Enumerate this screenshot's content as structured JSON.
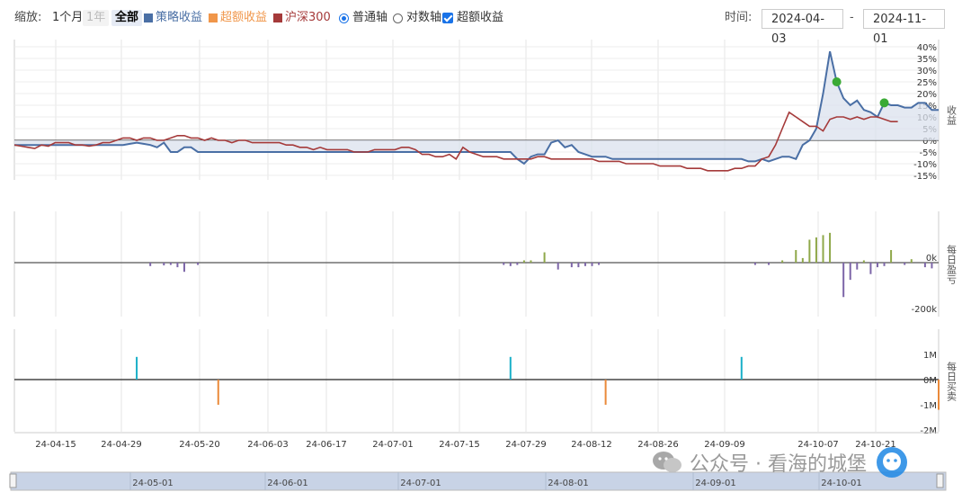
{
  "toolbar": {
    "zoom_label": "缩放:",
    "zoom_buttons": [
      "1个月",
      "1年",
      "全部"
    ],
    "legend": [
      {
        "label": "策略收益",
        "color": "#4a6fa5"
      },
      {
        "label": "超额收益",
        "color": "#f0964a"
      },
      {
        "label": "沪深300",
        "color": "#a53a3a"
      }
    ],
    "axis_modes": [
      "普通轴",
      "对数轴"
    ],
    "excess_toggle": "超额收益",
    "time_label": "时间:",
    "start_date": "2024-04-03",
    "date_separator": "-",
    "end_date": "2024-11-01"
  },
  "chart_data": [
    {
      "type": "line",
      "x_tick_labels": [
        "24-04-15",
        "24-04-29",
        "24-05-20",
        "24-06-03",
        "24-06-17",
        "24-07-01",
        "24-07-15",
        "24-07-29",
        "24-08-12",
        "24-08-26",
        "24-09-09",
        "24-10-07",
        "24-10-21"
      ],
      "ylabel": "收益",
      "y_tick_labels": [
        "40%",
        "35%",
        "30%",
        "25%",
        "20%",
        "15%",
        "10%",
        "5%",
        "0%",
        "-5%",
        "-10%",
        "-15%"
      ],
      "ylim": [
        -15,
        40
      ],
      "series": [
        {
          "name": "策略收益",
          "color": "#4a6fa5",
          "fill": "#dbe2ee",
          "values": [
            -2,
            -2,
            -2,
            -2,
            -2,
            -2,
            -2,
            -2,
            -2,
            -2,
            -2,
            -2,
            -2,
            -2,
            -2,
            -2,
            -2,
            -1.5,
            -1,
            -1.5,
            -2,
            -3,
            -1,
            -5,
            -5,
            -3,
            -3,
            -5,
            -5,
            -5,
            -5,
            -5,
            -5,
            -5,
            -5,
            -5,
            -5,
            -5,
            -5,
            -5,
            -5,
            -5,
            -5,
            -5,
            -5,
            -5,
            -5,
            -5,
            -5,
            -5,
            -5,
            -5,
            -5,
            -5,
            -5,
            -5,
            -5,
            -5,
            -5,
            -5,
            -5,
            -5,
            -5,
            -5,
            -5,
            -5,
            -5,
            -5,
            -5,
            -5,
            -5,
            -5,
            -5,
            -5,
            -8,
            -10,
            -7,
            -6,
            -6,
            -1,
            0,
            -3,
            -2,
            -5,
            -6,
            -7,
            -7,
            -7,
            -8,
            -8,
            -8,
            -8,
            -8,
            -8,
            -8,
            -8,
            -8,
            -8,
            -8,
            -8,
            -8,
            -8,
            -8,
            -8,
            -8,
            -8,
            -8,
            -8,
            -9,
            -9,
            -8,
            -9,
            -8,
            -7,
            -7,
            -8,
            -2,
            0,
            5,
            20,
            38,
            25,
            18,
            15,
            17,
            13,
            12,
            10,
            16,
            15,
            15,
            14,
            14,
            16,
            16,
            13,
            13
          ]
        },
        {
          "name": "沪深300",
          "color": "#a53a3a",
          "values": [
            -2,
            -2.5,
            -3,
            -3.5,
            -2,
            -2.5,
            -1,
            -1,
            -1,
            -2,
            -2,
            -2.5,
            -2,
            -1,
            -1,
            0,
            1,
            1,
            0,
            1,
            1,
            0,
            0,
            1,
            2,
            2,
            1,
            1,
            0,
            1,
            0,
            0,
            -1,
            0,
            0,
            -1,
            -1,
            -1,
            -1,
            -1,
            -2,
            -2,
            -3,
            -3,
            -4,
            -3,
            -4,
            -4,
            -4,
            -4,
            -5,
            -5,
            -5,
            -4,
            -4,
            -4,
            -4,
            -3,
            -3,
            -4,
            -6,
            -6,
            -7,
            -7,
            -6,
            -8,
            -3,
            -5,
            -6,
            -7,
            -7,
            -7,
            -8,
            -8,
            -8,
            -8,
            -8,
            -7,
            -7,
            -8,
            -8,
            -8,
            -8,
            -8,
            -8,
            -8,
            -9,
            -9,
            -9,
            -9,
            -10,
            -10,
            -10,
            -10,
            -10,
            -11,
            -11,
            -11,
            -11,
            -12,
            -12,
            -12,
            -13,
            -13,
            -13,
            -13,
            -12,
            -12,
            -11,
            -11,
            -8,
            -7,
            -2,
            5,
            12,
            10,
            8,
            6,
            6,
            4,
            9,
            10,
            10,
            9,
            10,
            9,
            10,
            10,
            9,
            8,
            8
          ]
        },
        {
          "name": "超额收益",
          "color": "#f0964a",
          "values": []
        }
      ],
      "markers": [
        {
          "index": 121,
          "series": "策略收益",
          "color": "#3aaa35"
        },
        {
          "index": 128,
          "series": "策略收益",
          "color": "#3aaa35"
        }
      ]
    },
    {
      "type": "bar",
      "ylabel": "每日盈亏",
      "y_tick_labels": [
        "0k",
        "-200k"
      ],
      "ylim": [
        -250,
        200
      ],
      "positive_color": "#8fa84a",
      "negative_color": "#7d66a8",
      "bars": [
        {
          "index": 20,
          "value": -15
        },
        {
          "index": 22,
          "value": -12
        },
        {
          "index": 23,
          "value": -10
        },
        {
          "index": 24,
          "value": -20
        },
        {
          "index": 25,
          "value": -40
        },
        {
          "index": 27,
          "value": -10
        },
        {
          "index": 72,
          "value": -10
        },
        {
          "index": 73,
          "value": -15
        },
        {
          "index": 74,
          "value": -10
        },
        {
          "index": 75,
          "value": 10
        },
        {
          "index": 76,
          "value": 10
        },
        {
          "index": 78,
          "value": 45
        },
        {
          "index": 80,
          "value": -30
        },
        {
          "index": 82,
          "value": -20
        },
        {
          "index": 83,
          "value": -20
        },
        {
          "index": 84,
          "value": -15
        },
        {
          "index": 85,
          "value": -15
        },
        {
          "index": 86,
          "value": -10
        },
        {
          "index": 109,
          "value": -10
        },
        {
          "index": 111,
          "value": -10
        },
        {
          "index": 113,
          "value": 10
        },
        {
          "index": 115,
          "value": 55
        },
        {
          "index": 116,
          "value": 20
        },
        {
          "index": 117,
          "value": 100
        },
        {
          "index": 118,
          "value": 110
        },
        {
          "index": 119,
          "value": 120
        },
        {
          "index": 120,
          "value": 130
        },
        {
          "index": 122,
          "value": -150
        },
        {
          "index": 123,
          "value": -75
        },
        {
          "index": 124,
          "value": -30
        },
        {
          "index": 125,
          "value": 10
        },
        {
          "index": 126,
          "value": -50
        },
        {
          "index": 127,
          "value": -20
        },
        {
          "index": 128,
          "value": -15
        },
        {
          "index": 129,
          "value": 55
        },
        {
          "index": 131,
          "value": -10
        },
        {
          "index": 132,
          "value": 15
        },
        {
          "index": 134,
          "value": -20
        },
        {
          "index": 135,
          "value": -25
        }
      ]
    },
    {
      "type": "bar",
      "ylabel": "每日买卖",
      "y_tick_labels": [
        "1M",
        "0M",
        "-1M",
        "-2M"
      ],
      "ylim": [
        -1.8,
        1.5
      ],
      "buy_color": "#1ab0c8",
      "sell_color": "#ea8a3a",
      "bars": [
        {
          "index": 18,
          "value": 0.9
        },
        {
          "index": 30,
          "value": -1.0
        },
        {
          "index": 73,
          "value": 0.9
        },
        {
          "index": 87,
          "value": -1.0
        },
        {
          "index": 107,
          "value": 0.9
        },
        {
          "index": 136,
          "value": -1.2
        }
      ]
    }
  ],
  "navigator": {
    "tick_labels": [
      "24-05-01",
      "24-06-01",
      "24-07-01",
      "24-08-01",
      "24-09-01",
      "24-10-01"
    ]
  },
  "watermark": {
    "text": "公众号 · 看海的城堡"
  }
}
